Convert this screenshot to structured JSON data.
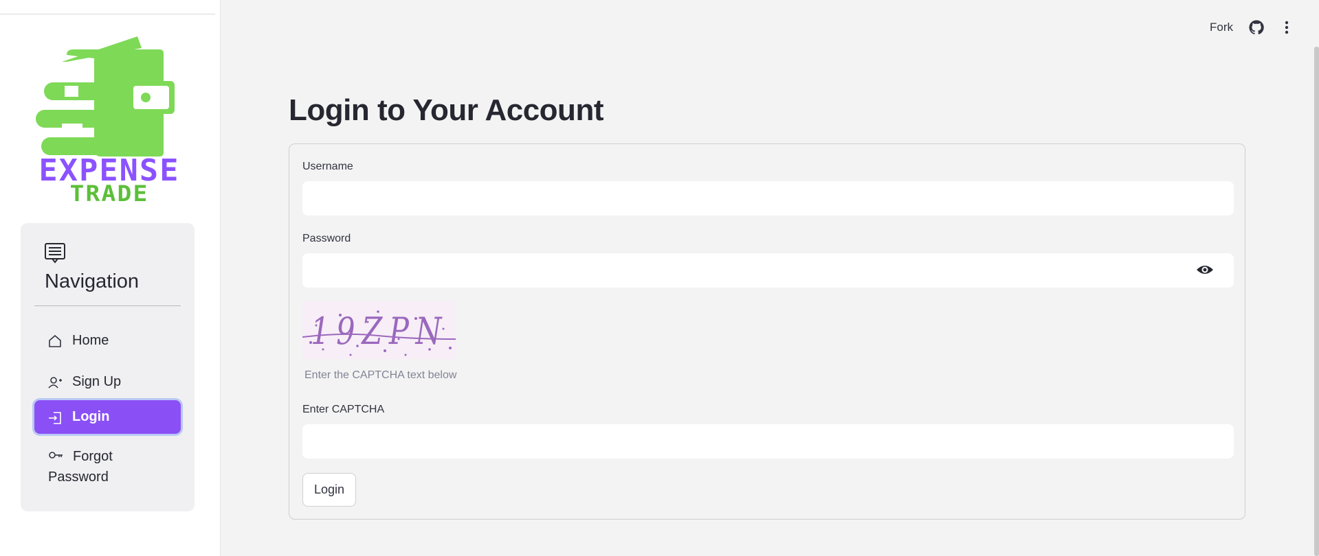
{
  "topbar": {
    "fork_label": "Fork",
    "github_icon": "github-icon",
    "menu_icon": "kebab-menu-icon"
  },
  "sidebar": {
    "logo": {
      "line1": "EXPENSE",
      "line2": "TRADE",
      "colors": {
        "green": "#7ed957",
        "purple": "#8b52ff"
      }
    },
    "nav_title": "Navigation",
    "items": [
      {
        "label": "Home",
        "icon": "home-icon",
        "active": false
      },
      {
        "label": "Sign Up",
        "icon": "add-user-icon",
        "active": false
      },
      {
        "label": "Login",
        "icon": "login-icon",
        "active": true
      },
      {
        "label_line1": "Forgot",
        "label_line2": "Password",
        "icon": "key-icon",
        "active": false
      }
    ]
  },
  "main": {
    "title": "Login to Your Account",
    "username": {
      "label": "Username",
      "value": ""
    },
    "password": {
      "label": "Password",
      "value": ""
    },
    "captcha": {
      "image_text": "19ZPN",
      "hint": "Enter the CAPTCHA text below"
    },
    "captcha_input": {
      "label": "Enter CAPTCHA",
      "value": ""
    },
    "submit_label": "Login"
  },
  "colors": {
    "accent": "#8a50f5",
    "background": "#f3f3f3",
    "sidebar": "#ffffff",
    "nav_card": "#f0f0f2"
  }
}
